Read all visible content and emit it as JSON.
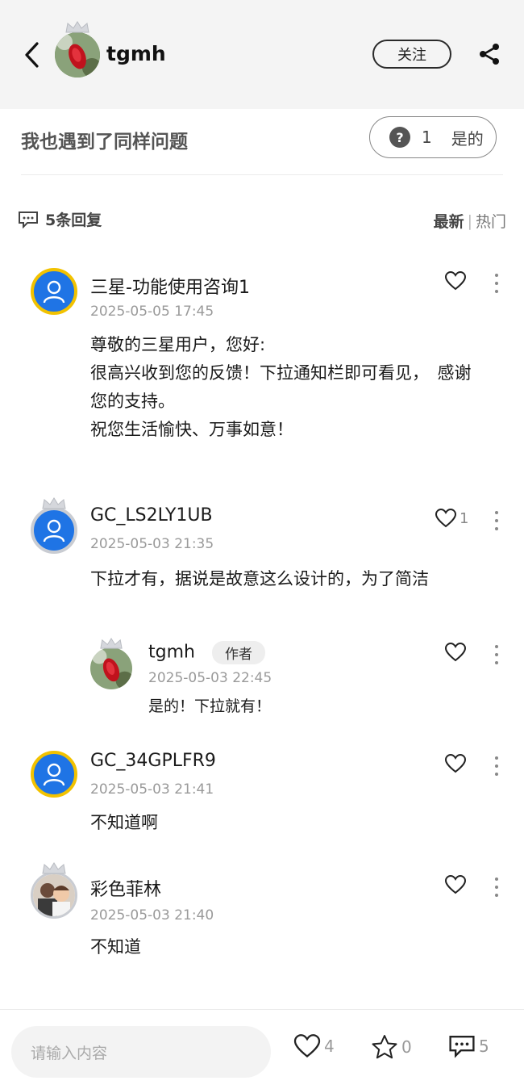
{
  "header": {
    "author_name": "tgmh",
    "follow_label": "关注"
  },
  "question": {
    "text": "我也遇到了同样问题",
    "same_count": "1",
    "same_label": "是的"
  },
  "replies": {
    "count_label": "5条回复",
    "sort_latest": "最新",
    "sort_separator": "|",
    "sort_hot": "热门"
  },
  "comments": [
    {
      "name": "三星-功能使用咨询1",
      "date": "2025-05-05 17:45",
      "body": "尊敬的三星用户，您好:\n很高兴收到您的反馈！下拉通知栏即可看见，　感谢您的支持。\n祝您生活愉快、万事如意！",
      "likes": ""
    },
    {
      "name": "GC_LS2LY1UB",
      "date": "2025-05-03 21:35",
      "body": "下拉才有，据说是故意这么设计的，为了简洁",
      "likes": "1"
    },
    {
      "name": "GC_34GPLFR9",
      "date": "2025-05-03 21:41",
      "body": "不知道啊",
      "likes": ""
    },
    {
      "name": "彩色菲林",
      "date": "2025-05-03 21:40",
      "body": "不知道",
      "likes": ""
    }
  ],
  "nested_reply": {
    "name": "tgmh",
    "badge": "作者",
    "date": "2025-05-03 22:45",
    "body": "是的！下拉就有！"
  },
  "bottom_bar": {
    "input_placeholder": "请输入内容",
    "likes": "4",
    "favorites": "0",
    "comments": "5"
  },
  "colors": {
    "default_avatar_blue": "#1f74e5",
    "gold_ring": "#f2c200",
    "header_bg": "#f4f4f4"
  }
}
